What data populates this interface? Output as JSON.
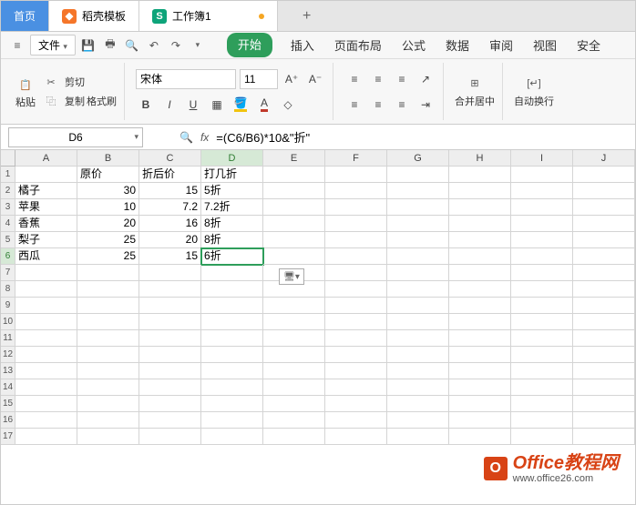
{
  "topTabs": {
    "home": "首页",
    "docer": "稻壳模板",
    "sheet": "工作簿1"
  },
  "menu": {
    "file": "文件",
    "tabs": [
      "开始",
      "插入",
      "页面布局",
      "公式",
      "数据",
      "审阅",
      "视图",
      "安全"
    ]
  },
  "toolbar": {
    "paste": "粘贴",
    "cut": "剪切",
    "copy": "复制",
    "fmtPainter": "格式刷",
    "font": "宋体",
    "fontSize": "11",
    "merge": "合并居中",
    "wrap": "自动换行"
  },
  "nameBox": "D6",
  "formula": "=(C6/B6)*10&\"折\"",
  "columns": [
    "A",
    "B",
    "C",
    "D",
    "E",
    "F",
    "G",
    "H",
    "I",
    "J"
  ],
  "rowCount": 17,
  "header": {
    "b": "原价",
    "c": "折后价",
    "d": "打几折"
  },
  "rows": [
    {
      "a": "橘子",
      "b": "30",
      "c": "15",
      "d": "5折"
    },
    {
      "a": "苹果",
      "b": "10",
      "c": "7.2",
      "d": "7.2折"
    },
    {
      "a": "香蕉",
      "b": "20",
      "c": "16",
      "d": "8折"
    },
    {
      "a": "梨子",
      "b": "25",
      "c": "20",
      "d": "8折"
    },
    {
      "a": "西瓜",
      "b": "25",
      "c": "15",
      "d": "6折"
    }
  ],
  "activeCell": {
    "row": 6,
    "col": "D"
  },
  "watermark": {
    "brand": "Office教程网",
    "url": "www.office26.com"
  }
}
